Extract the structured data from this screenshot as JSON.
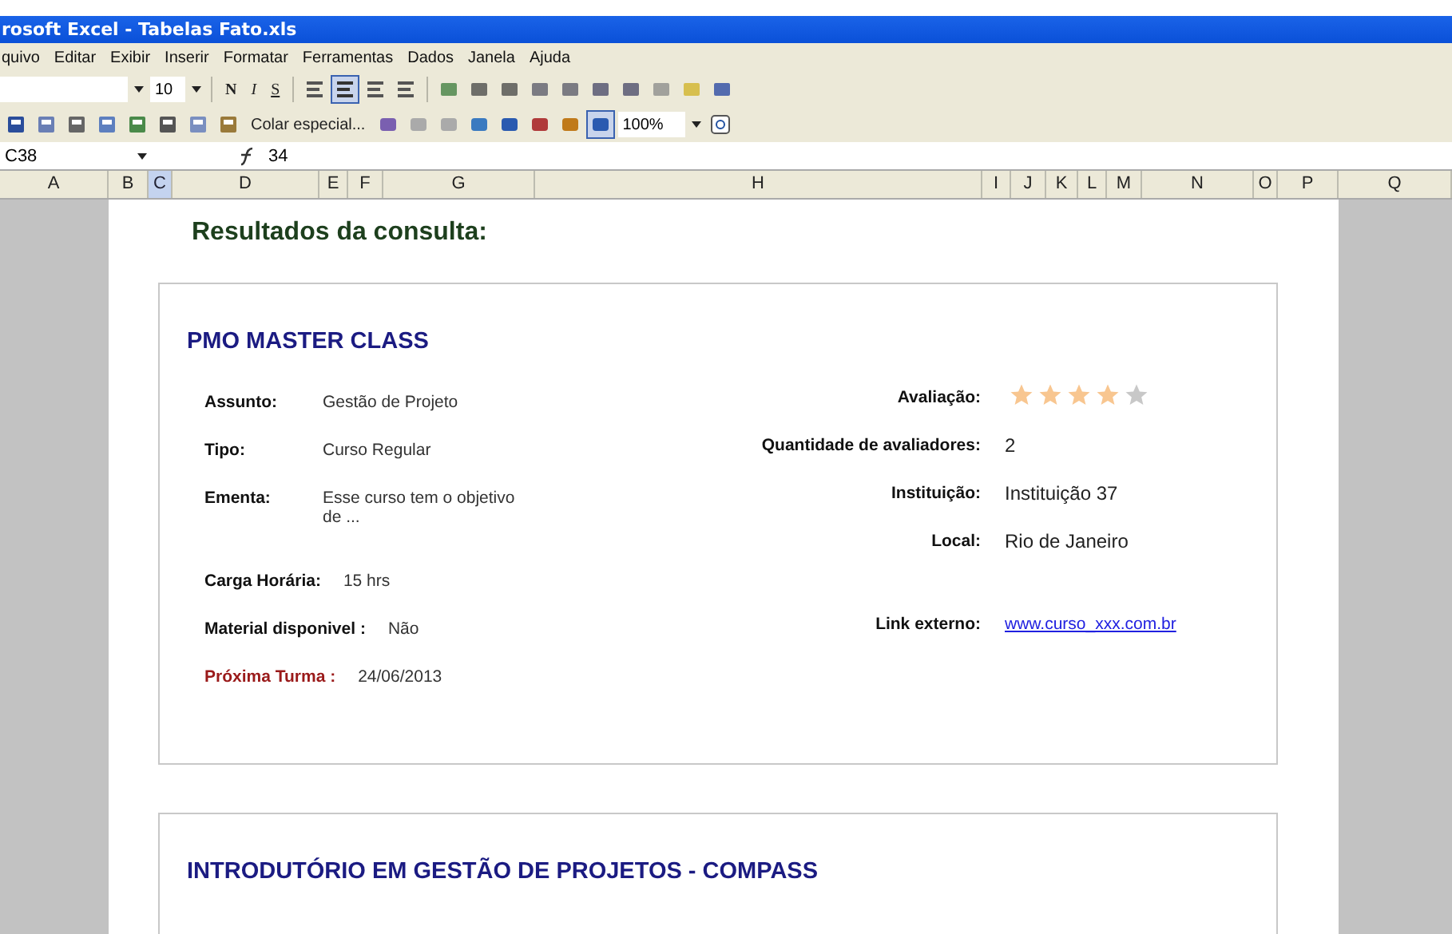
{
  "window": {
    "title": "rosoft Excel - Tabelas Fato.xls"
  },
  "menu": [
    "quivo",
    "Editar",
    "Exibir",
    "Inserir",
    "Formatar",
    "Ferramentas",
    "Dados",
    "Janela",
    "Ajuda"
  ],
  "format_toolbar": {
    "font_size": "10",
    "bold": "N",
    "italic": "I",
    "underline": "S"
  },
  "standard_toolbar": {
    "paste_special": "Colar especial...",
    "zoom": "100%"
  },
  "formula_bar": {
    "name_box": "C38",
    "value": "34"
  },
  "columns": [
    {
      "label": "A",
      "selected": false
    },
    {
      "label": "B",
      "selected": false
    },
    {
      "label": "C",
      "selected": true
    },
    {
      "label": "D",
      "selected": false
    },
    {
      "label": "E",
      "selected": false
    },
    {
      "label": "F",
      "selected": false
    },
    {
      "label": "G",
      "selected": false
    },
    {
      "label": "H",
      "selected": false
    },
    {
      "label": "I",
      "selected": false
    },
    {
      "label": "J",
      "selected": false
    },
    {
      "label": "K",
      "selected": false
    },
    {
      "label": "L",
      "selected": false
    },
    {
      "label": "M",
      "selected": false
    },
    {
      "label": "N",
      "selected": false
    },
    {
      "label": "O",
      "selected": false
    },
    {
      "label": "P",
      "selected": false
    },
    {
      "label": "Q",
      "selected": false
    }
  ],
  "heading": "Resultados da consulta:",
  "results": [
    {
      "title": "PMO MASTER CLASS",
      "left": [
        {
          "kind": "aligned",
          "label": "Assunto:",
          "value": "Gestão de Projeto"
        },
        {
          "kind": "aligned",
          "label": "Tipo:",
          "value": "Curso Regular"
        },
        {
          "kind": "aligned",
          "label": "Ementa:",
          "value": "Esse curso tem o objetivo de ..."
        },
        {
          "kind": "inline",
          "label": "Carga Horária:",
          "value": "15 hrs"
        },
        {
          "kind": "inline",
          "label": "Material disponivel :",
          "value": "Não"
        },
        {
          "kind": "accent",
          "label": "Próxima Turma :",
          "value": "24/06/2013"
        }
      ],
      "right": [
        {
          "kind": "stars",
          "label": "Avaliação:",
          "stars": 4
        },
        {
          "kind": "text",
          "label": "Quantidade de avaliadores:",
          "value": "2"
        },
        {
          "kind": "text",
          "label": "Instituição:",
          "value": "Instituição 37"
        },
        {
          "kind": "text",
          "label": "Local:",
          "value": "Rio de Janeiro"
        },
        {
          "kind": "link",
          "label": "Link externo:",
          "value": "www.curso_xxx.com.br"
        }
      ]
    },
    {
      "title": "INTRODUTÓRIO EM GESTÃO DE PROJETOS - COMPASS"
    }
  ]
}
